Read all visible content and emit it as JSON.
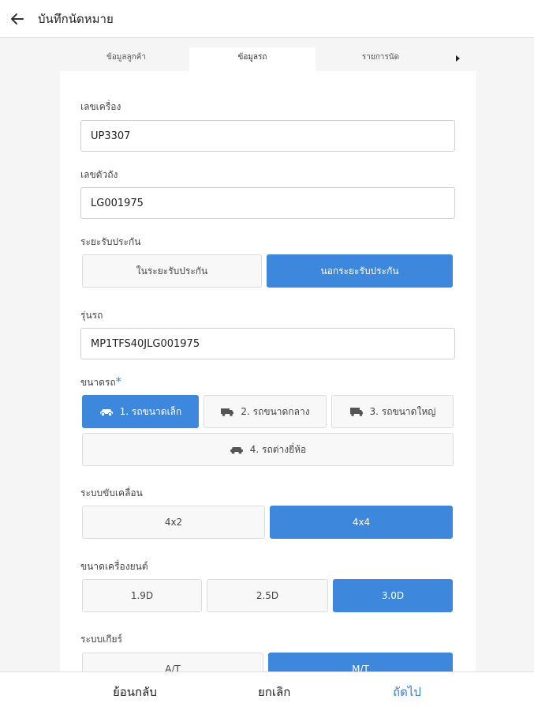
{
  "header": {
    "title": "บันทึกนัดหมาย",
    "back_icon": "arrow-left-icon"
  },
  "tabs": [
    {
      "label": "ข้อมูลลูกค้า",
      "active": false
    },
    {
      "label": "ข้อมูลรถ",
      "active": true
    },
    {
      "label": "รายการนัด",
      "active": false
    }
  ],
  "tabs_more_icon": "caret-right-icon",
  "form": {
    "machine_no": {
      "label": "เลขเครื่อง",
      "value": "UP3307"
    },
    "chassis_no": {
      "label": "เลขตัวถัง",
      "value": "LG001975"
    },
    "warranty": {
      "label": "ระยะรับประกัน",
      "options": [
        "ในระยะรับประกัน",
        "นอกระยะรับประกัน"
      ],
      "selected": 1
    },
    "model": {
      "label": "รุ่นรถ",
      "value": "MP1TFS40JLG001975"
    },
    "car_size": {
      "label": "ขนาดรถ",
      "required_mark": "*",
      "options": [
        {
          "label": "1. รถขนาดเล็ก",
          "icon": "car-small-icon"
        },
        {
          "label": "2. รถขนาดกลาง",
          "icon": "truck-medium-icon"
        },
        {
          "label": "3. รถขนาดใหญ่",
          "icon": "truck-large-icon"
        },
        {
          "label": "4. รถต่างยี่ห้อ",
          "icon": "car-other-brand-icon"
        }
      ],
      "selected": 0
    },
    "drive": {
      "label": "ระบบขับเคลื่อน",
      "options": [
        "4x2",
        "4x4"
      ],
      "selected": 1
    },
    "engine": {
      "label": "ขนาดเครื่องยนต์",
      "options": [
        "1.9D",
        "2.5D",
        "3.0D"
      ],
      "selected": 2
    },
    "gear": {
      "label": "ระบบเกียร์",
      "options": [
        "A/T",
        "M/T"
      ],
      "selected": 1
    }
  },
  "footer": {
    "back": "ย้อนกลับ",
    "cancel": "ยกเลิก",
    "next": "ถัดไป"
  },
  "colors": {
    "accent": "#3d87dc",
    "accent_text": "#2f7fd9"
  }
}
